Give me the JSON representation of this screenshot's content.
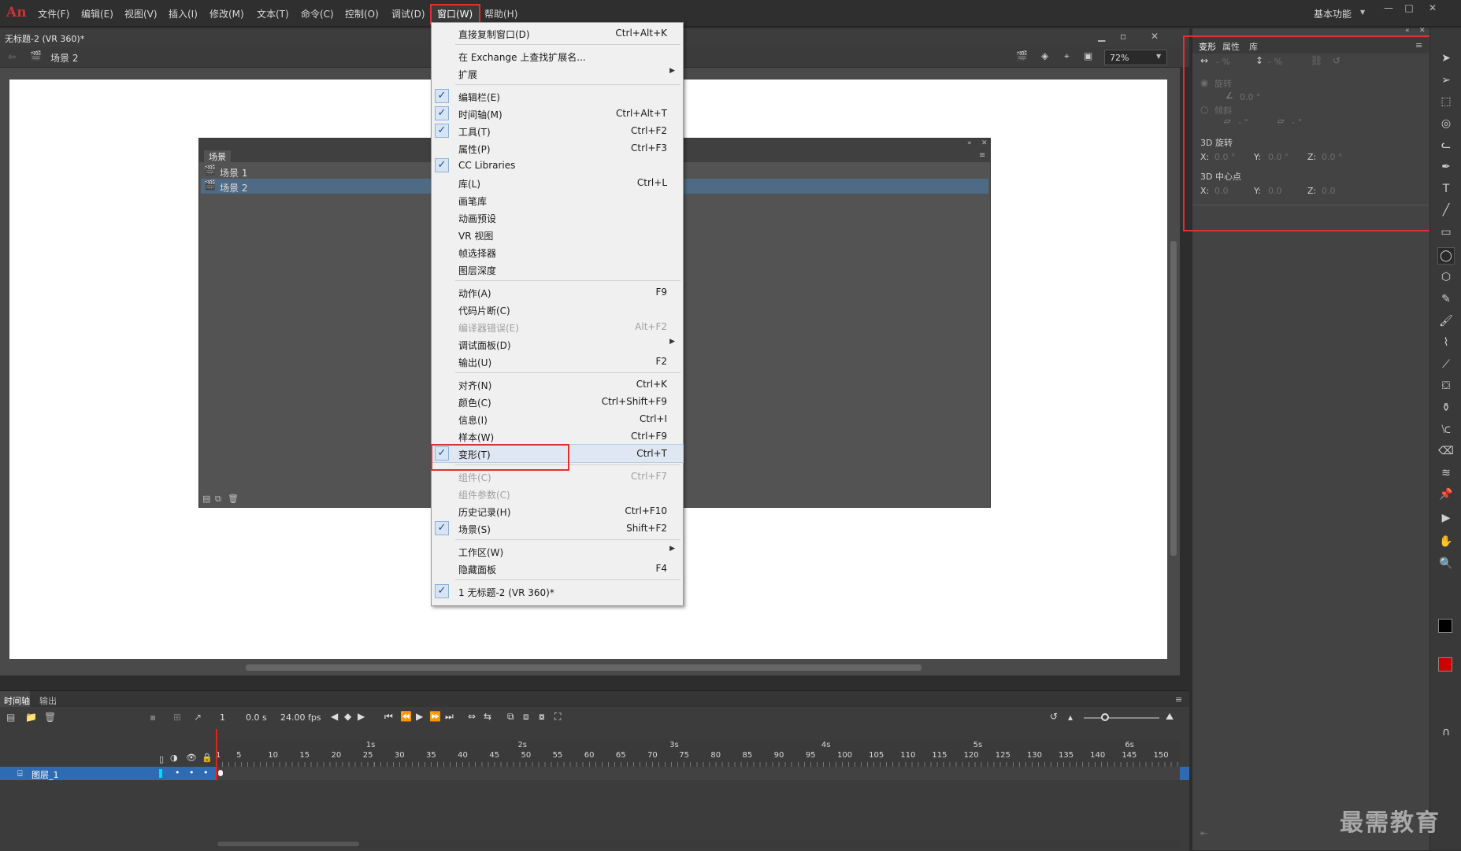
{
  "app": {
    "logo": "An",
    "workspace": "基本功能",
    "document_title": "无标题-2 (VR 360)*"
  },
  "menu": [
    "文件(F)",
    "编辑(E)",
    "视图(V)",
    "插入(I)",
    "修改(M)",
    "文本(T)",
    "命令(C)",
    "控制(O)",
    "调试(D)",
    "窗口(W)",
    "帮助(H)"
  ],
  "scene_bar": {
    "current_scene": "场景 2",
    "zoom": "72%"
  },
  "scene_panel": {
    "title": "场景",
    "scenes": [
      "场景 1",
      "场景 2"
    ],
    "selected_index": 1
  },
  "window_menu": {
    "items": [
      {
        "label": "直接复制窗口(D)",
        "shortcut": "Ctrl+Alt+K",
        "checked": false,
        "disabled": false,
        "submenu": false
      },
      {
        "sep": true
      },
      {
        "label": "在 Exchange 上查找扩展名...",
        "shortcut": "",
        "checked": false,
        "disabled": false,
        "submenu": false
      },
      {
        "label": "扩展",
        "shortcut": "",
        "checked": false,
        "disabled": false,
        "submenu": true
      },
      {
        "sep": true
      },
      {
        "label": "编辑栏(E)",
        "shortcut": "",
        "checked": true,
        "disabled": false,
        "submenu": false
      },
      {
        "label": "时间轴(M)",
        "shortcut": "Ctrl+Alt+T",
        "checked": true,
        "disabled": false,
        "submenu": false
      },
      {
        "label": "工具(T)",
        "shortcut": "Ctrl+F2",
        "checked": true,
        "disabled": false,
        "submenu": false
      },
      {
        "label": "属性(P)",
        "shortcut": "Ctrl+F3",
        "checked": false,
        "disabled": false,
        "submenu": false
      },
      {
        "label": "CC Libraries",
        "shortcut": "",
        "checked": true,
        "disabled": false,
        "submenu": false
      },
      {
        "label": "库(L)",
        "shortcut": "Ctrl+L",
        "checked": false,
        "disabled": false,
        "submenu": false
      },
      {
        "label": "画笔库",
        "shortcut": "",
        "checked": false,
        "disabled": false,
        "submenu": false
      },
      {
        "label": "动画预设",
        "shortcut": "",
        "checked": false,
        "disabled": false,
        "submenu": false
      },
      {
        "label": "VR 视图",
        "shortcut": "",
        "checked": false,
        "disabled": false,
        "submenu": false
      },
      {
        "label": "帧选择器",
        "shortcut": "",
        "checked": false,
        "disabled": false,
        "submenu": false
      },
      {
        "label": "图层深度",
        "shortcut": "",
        "checked": false,
        "disabled": false,
        "submenu": false
      },
      {
        "sep": true
      },
      {
        "label": "动作(A)",
        "shortcut": "F9",
        "checked": false,
        "disabled": false,
        "submenu": false
      },
      {
        "label": "代码片断(C)",
        "shortcut": "",
        "checked": false,
        "disabled": false,
        "submenu": false
      },
      {
        "label": "编译器错误(E)",
        "shortcut": "Alt+F2",
        "checked": false,
        "disabled": true,
        "submenu": false
      },
      {
        "label": "调试面板(D)",
        "shortcut": "",
        "checked": false,
        "disabled": false,
        "submenu": true
      },
      {
        "label": "输出(U)",
        "shortcut": "F2",
        "checked": false,
        "disabled": false,
        "submenu": false
      },
      {
        "sep": true
      },
      {
        "label": "对齐(N)",
        "shortcut": "Ctrl+K",
        "checked": false,
        "disabled": false,
        "submenu": false
      },
      {
        "label": "颜色(C)",
        "shortcut": "Ctrl+Shift+F9",
        "checked": false,
        "disabled": false,
        "submenu": false
      },
      {
        "label": "信息(I)",
        "shortcut": "Ctrl+I",
        "checked": false,
        "disabled": false,
        "submenu": false
      },
      {
        "label": "样本(W)",
        "shortcut": "Ctrl+F9",
        "checked": false,
        "disabled": false,
        "submenu": false
      },
      {
        "label": "变形(T)",
        "shortcut": "Ctrl+T",
        "checked": true,
        "disabled": false,
        "submenu": false,
        "hover": true
      },
      {
        "sep": true
      },
      {
        "label": "组件(C)",
        "shortcut": "Ctrl+F7",
        "checked": false,
        "disabled": true,
        "submenu": false
      },
      {
        "label": "组件参数(C)",
        "shortcut": "",
        "checked": false,
        "disabled": true,
        "submenu": false
      },
      {
        "label": "历史记录(H)",
        "shortcut": "Ctrl+F10",
        "checked": false,
        "disabled": false,
        "submenu": false
      },
      {
        "label": "场景(S)",
        "shortcut": "Shift+F2",
        "checked": true,
        "disabled": false,
        "submenu": false
      },
      {
        "sep": true
      },
      {
        "label": "工作区(W)",
        "shortcut": "",
        "checked": false,
        "disabled": false,
        "submenu": true
      },
      {
        "label": "隐藏面板",
        "shortcut": "F4",
        "checked": false,
        "disabled": false,
        "submenu": false
      },
      {
        "sep": true
      },
      {
        "label": "1 无标题-2 (VR 360)*",
        "shortcut": "",
        "checked": true,
        "disabled": false,
        "submenu": false
      }
    ]
  },
  "transform_panel": {
    "tabs": [
      "变形",
      "属性",
      "库"
    ],
    "width_value": "- %",
    "height_value": "- %",
    "rotate_label": "旋转",
    "rotate_value": "0.0 °",
    "skew_label": "倾斜",
    "skew_h": "- °",
    "skew_v": "- °",
    "rotate3d_label": "3D 旋转",
    "center3d_label": "3D 中心点",
    "rot3d": {
      "x": "0.0 °",
      "y": "0.0 °",
      "z": "0.0 °"
    },
    "center3d": {
      "x": "0.0",
      "y": "0.0",
      "z": "0.0"
    },
    "axis_x": "X:",
    "axis_y": "Y:",
    "axis_z": "Z:"
  },
  "timeline": {
    "tabs": [
      "时间轴",
      "输出"
    ],
    "frame": "1",
    "time": "0.0 s",
    "fps": "24.00 fps",
    "layer_name": "图层_1",
    "seconds": [
      "1s",
      "2s",
      "3s",
      "4s",
      "5s",
      "6s"
    ],
    "frame_ticks": [
      "1",
      "5",
      "10",
      "15",
      "20",
      "25",
      "30",
      "35",
      "40",
      "45",
      "50",
      "55",
      "60",
      "65",
      "70",
      "75",
      "80",
      "85",
      "90",
      "95",
      "100",
      "105",
      "110",
      "115",
      "120",
      "125",
      "130",
      "135",
      "140",
      "145",
      "150"
    ]
  },
  "watermark": "最需教育",
  "colors": {
    "accent_red": "#e03030",
    "selection_blue": "#2f6bb2",
    "fill_color": "#cc0000"
  },
  "tools": [
    "selection-icon",
    "subselection-icon",
    "free-transform-icon",
    "3d-rotate-icon",
    "lasso-icon",
    "pen-icon",
    "text-icon",
    "line-icon",
    "rectangle-icon",
    "oval-icon",
    "polystar-icon",
    "pencil-icon",
    "brush-icon",
    "paint-brush-icon",
    "bone-icon",
    "paint-bucket-icon",
    "ink-bottle-icon",
    "eyedropper-icon",
    "eraser-icon",
    "width-icon",
    "pin-icon",
    "camera-icon",
    "hand-icon",
    "zoom-icon"
  ]
}
